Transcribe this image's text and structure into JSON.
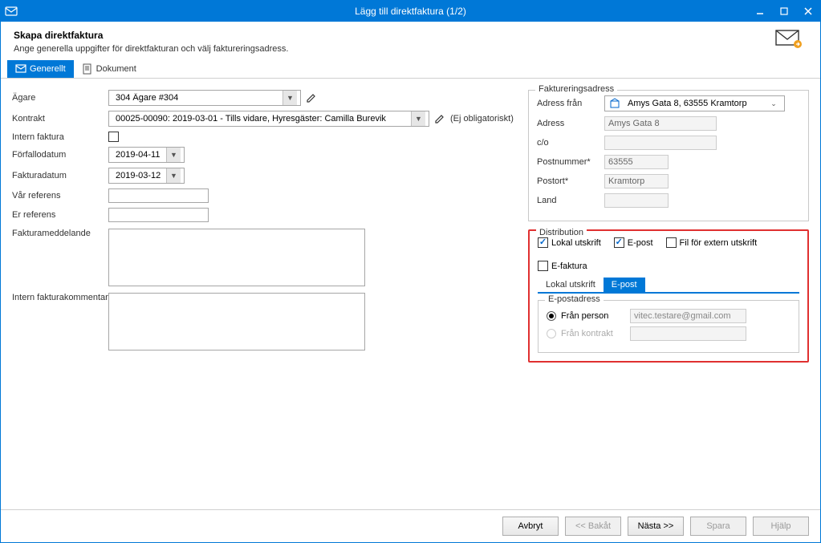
{
  "titlebar": {
    "title": "Lägg till direktfaktura (1/2)"
  },
  "header": {
    "title": "Skapa direktfaktura",
    "subtitle": "Ange generella uppgifter för direktfakturan och välj faktureringsadress."
  },
  "tabs": {
    "generellt": "Generellt",
    "dokument": "Dokument"
  },
  "form": {
    "owner_label": "Ägare",
    "owner_value": "304   Ägare #304",
    "contract_label": "Kontrakt",
    "contract_value": "00025-00090: 2019-03-01 - Tills vidare, Hyresgäster: Camilla Burevik",
    "contract_note": "(Ej obligatoriskt)",
    "internal_invoice_label": "Intern faktura",
    "due_label": "Förfallodatum",
    "due_value": "2019-04-11",
    "invoice_date_label": "Fakturadatum",
    "invoice_date_value": "2019-03-12",
    "our_ref_label": "Vår referens",
    "your_ref_label": "Er referens",
    "invoice_msg_label": "Fakturameddelande",
    "internal_comment_label": "Intern fakturakommentar"
  },
  "address": {
    "legend": "Faktureringsadress",
    "from_label": "Adress från",
    "from_value": "Amys Gata 8, 63555 Kramtorp",
    "adress_label": "Adress",
    "adress_value": "Amys Gata 8",
    "co_label": "c/o",
    "co_value": "",
    "postnr_label": "Postnummer*",
    "postnr_value": "63555",
    "postort_label": "Postort*",
    "postort_value": "Kramtorp",
    "land_label": "Land",
    "land_value": ""
  },
  "distribution": {
    "legend": "Distribution",
    "local": "Lokal utskrift",
    "epost": "E-post",
    "fil": "Fil för extern utskrift",
    "efaktura": "E-faktura",
    "tab_local": "Lokal utskrift",
    "tab_epost": "E-post"
  },
  "epost": {
    "legend": "E-postadress",
    "from_person_label": "Från person",
    "from_contract_label": "Från kontrakt",
    "email_value": "vitec.testare@gmail.com"
  },
  "buttons": {
    "cancel": "Avbryt",
    "back": "<< Bakåt",
    "next": "Nästa >>",
    "save": "Spara",
    "help": "Hjälp"
  }
}
